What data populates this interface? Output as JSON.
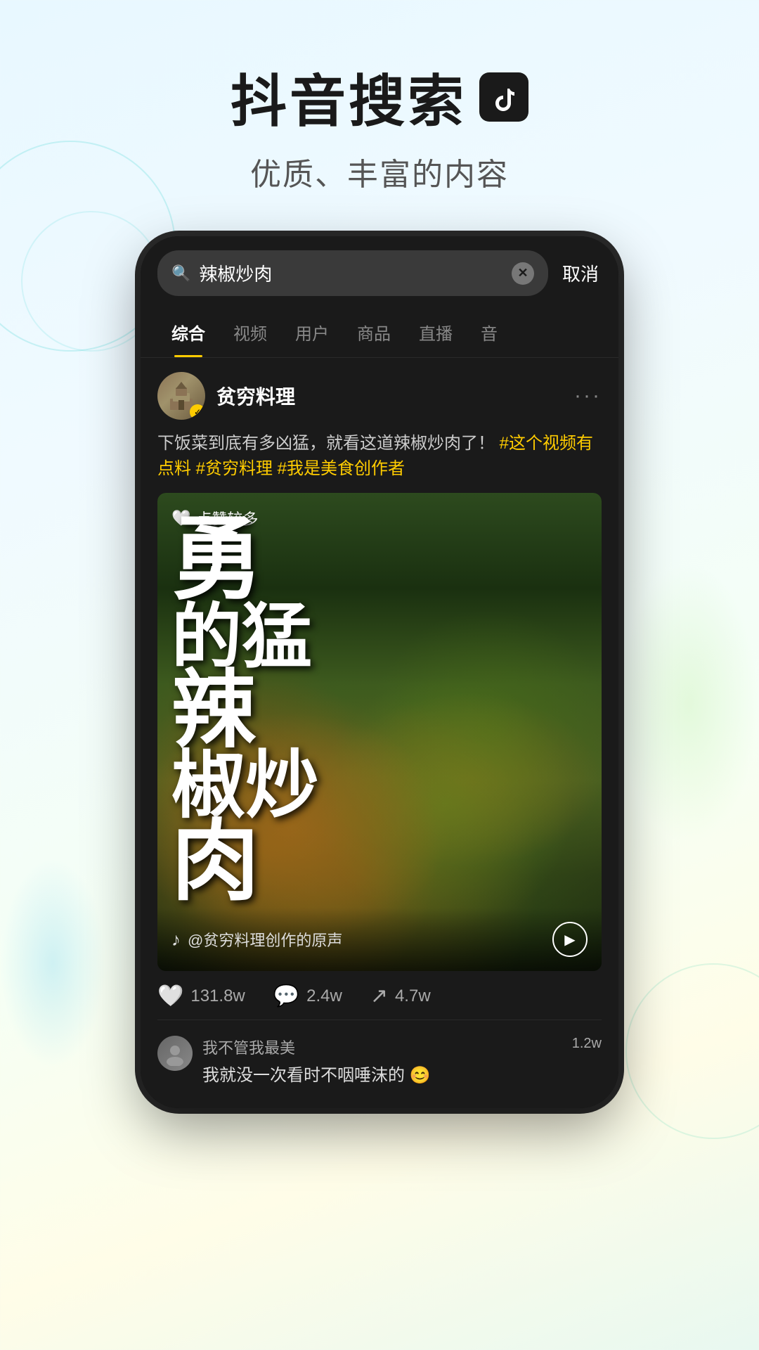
{
  "header": {
    "title": "抖音搜索",
    "logo_icon": "♪",
    "subtitle": "优质、丰富的内容"
  },
  "phone": {
    "search": {
      "query": "辣椒炒肉",
      "placeholder": "辣椒炒肉",
      "cancel_label": "取消"
    },
    "tabs": [
      {
        "label": "综合",
        "active": true
      },
      {
        "label": "视频",
        "active": false
      },
      {
        "label": "用户",
        "active": false
      },
      {
        "label": "商品",
        "active": false
      },
      {
        "label": "直播",
        "active": false
      },
      {
        "label": "音",
        "active": false
      }
    ],
    "post": {
      "username": "贫穷料理",
      "verified": true,
      "description": "下饭菜到底有多凶猛，就看这道辣椒炒肉了！",
      "hashtags": [
        "#这个视频有点料",
        "#贫穷料理",
        "#我是美食创作者"
      ],
      "video": {
        "likes_badge": "点赞较多",
        "big_text_lines": [
          "勇",
          "的猛",
          "辣",
          "椒炒",
          "肉"
        ],
        "display_text": "勇的猛辣椒炒肉",
        "audio": "@贫穷料理创作的原声",
        "tiktok_symbol": "♪"
      },
      "engagement": {
        "likes": "131.8w",
        "comments": "2.4w",
        "shares": "4.7w"
      },
      "comments": [
        {
          "username": "我不管我最美",
          "text": "我就没一次看时不咽唾沫的 😊",
          "likes": "1.2w"
        }
      ]
    }
  },
  "icons": {
    "search": "🔍",
    "heart": "♡",
    "heart_filled": "🤍",
    "comment": "💬",
    "share": "↗",
    "play": "▶",
    "more": "···",
    "verified_check": "✓",
    "tiktok_note": "♪"
  }
}
